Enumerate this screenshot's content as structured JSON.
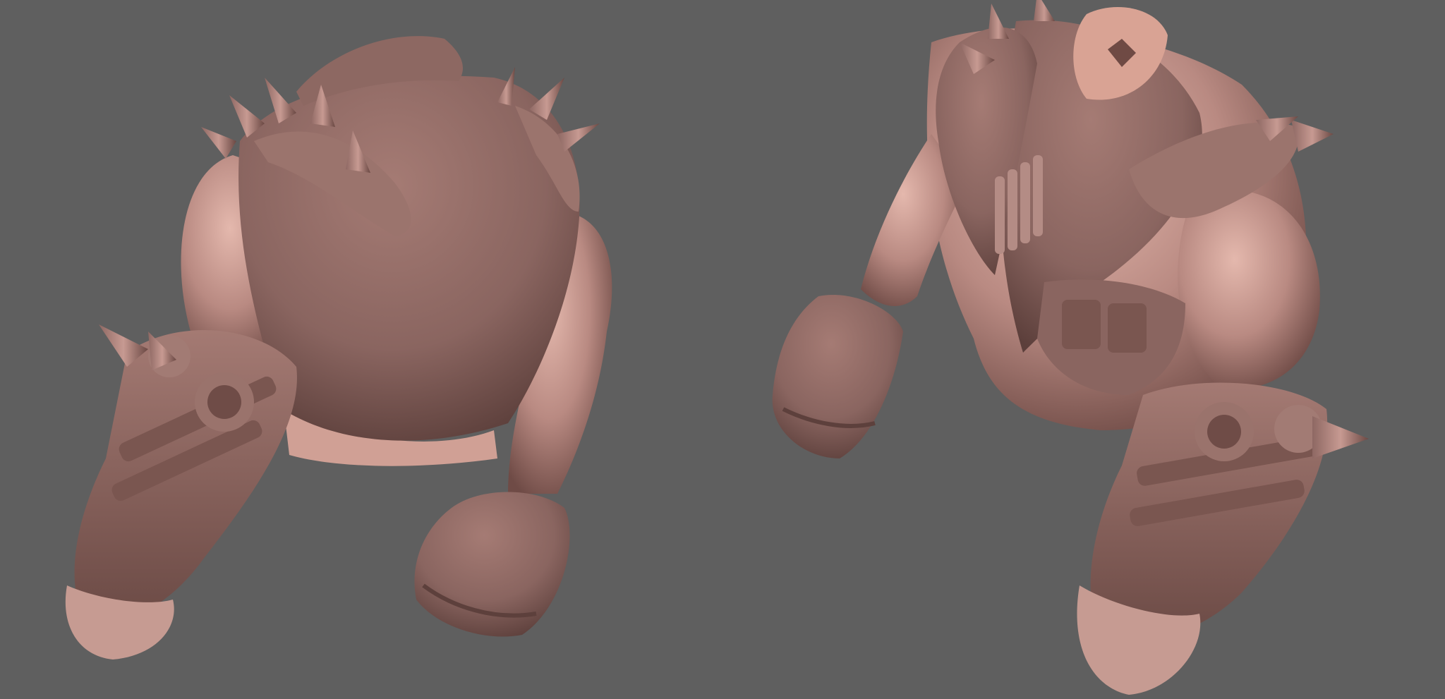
{
  "scene": {
    "background_color": "#5f5f5f",
    "material_color": "#b98a82",
    "material_shadow": "#6e4a45",
    "material_highlight": "#e2b7ac",
    "models": [
      {
        "view": "back",
        "description_icon": "sculpt-back-view"
      },
      {
        "view": "front-three-quarter",
        "description_icon": "sculpt-front-view"
      }
    ]
  }
}
